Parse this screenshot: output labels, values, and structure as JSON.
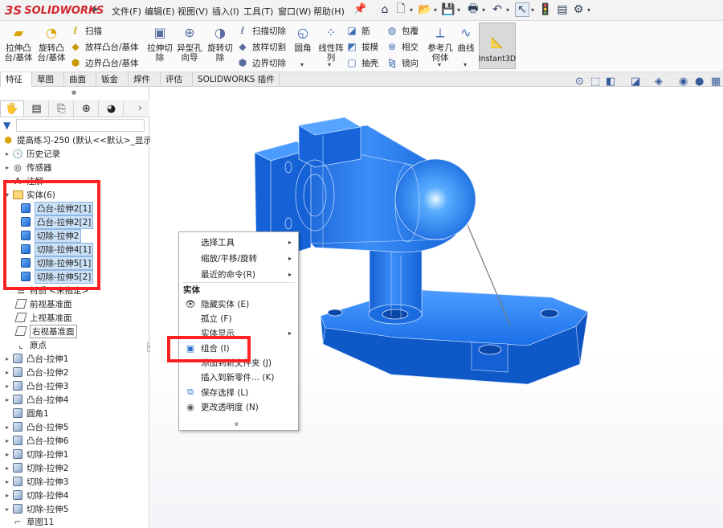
{
  "app": {
    "logo_text": "SOLIDWORKS",
    "logo_mark": "3S",
    "brand_color": "#d22630"
  },
  "menu": [
    "文件(F)",
    "编辑(E)",
    "视图(V)",
    "插入(I)",
    "工具(T)",
    "窗口(W)",
    "帮助(H)"
  ],
  "ribbon": {
    "extrude_boss": "拉伸凸\n台/基体",
    "revolve_boss": "旋转凸\n台/基体",
    "sweep": "扫描",
    "loft_boss": "放样凸台/基体",
    "boundary_boss": "边界凸台/基体",
    "extrude_cut": "拉伸切\n除",
    "hole_wizard": "异型孔\n向导",
    "revolve_cut": "旋转切\n除",
    "swept_cut": "扫描切除",
    "lofted_cut": "放样切割",
    "boundary_cut": "边界切除",
    "fillet": "圆角",
    "linear_pattern": "线性阵\n列",
    "rib": "筋",
    "draft": "拔模",
    "shell": "抽壳",
    "wrap": "包覆",
    "intersect": "相交",
    "mirror": "镜向",
    "ref_geometry": "参考几\n何体",
    "curves": "曲线",
    "instant3d": "Instant3D"
  },
  "tabs": [
    "特征",
    "草图",
    "曲面",
    "钣金",
    "焊件",
    "评估",
    "SOLIDWORKS 插件"
  ],
  "tree": {
    "root": "提高练习-250  (默认<<默认>_显示状态",
    "history": "历史记录",
    "sensors": "传感器",
    "annotations": "注解",
    "solid_bodies": "实体(6)",
    "bodies": [
      "凸台-拉伸2[1]",
      "凸台-拉伸2[2]",
      "切除-拉伸2",
      "切除-拉伸4[1]",
      "切除-拉伸5[1]",
      "切除-拉伸5[2]"
    ],
    "material": "材质 <未指定>",
    "front_plane": "前视基准面",
    "top_plane": "上视基准面",
    "right_plane": "右视基准面",
    "origin": "原点",
    "features": [
      "凸台-拉伸1",
      "凸台-拉伸2",
      "凸台-拉伸3",
      "凸台-拉伸4",
      "圆角1",
      "凸台-拉伸5",
      "凸台-拉伸6",
      "切除-拉伸1",
      "切除-拉伸2",
      "切除-拉伸3",
      "切除-拉伸4",
      "切除-拉伸5",
      "草图11"
    ]
  },
  "context_menu": {
    "select_tools": "选择工具",
    "zoom_pan_rotate": "缩放/平移/旋转",
    "recent_commands": "最近的命令(R)",
    "section_header": "实体",
    "hide_bodies": "隐藏实体 (E)",
    "isolate": "孤立 (F)",
    "body_display": "实体显示",
    "combine": "组合 (I)",
    "add_to_folder": "添加到新文件夹 (J)",
    "insert_new_part": "插入到新零件... (K)",
    "save_selection": "保存选择 (L)",
    "change_transparency": "更改透明度 (N)",
    "more": "»"
  },
  "colors": {
    "model_blue": "#1e78f0",
    "highlight_red": "#ff2222",
    "selection_blue": "#cbe1f7"
  }
}
